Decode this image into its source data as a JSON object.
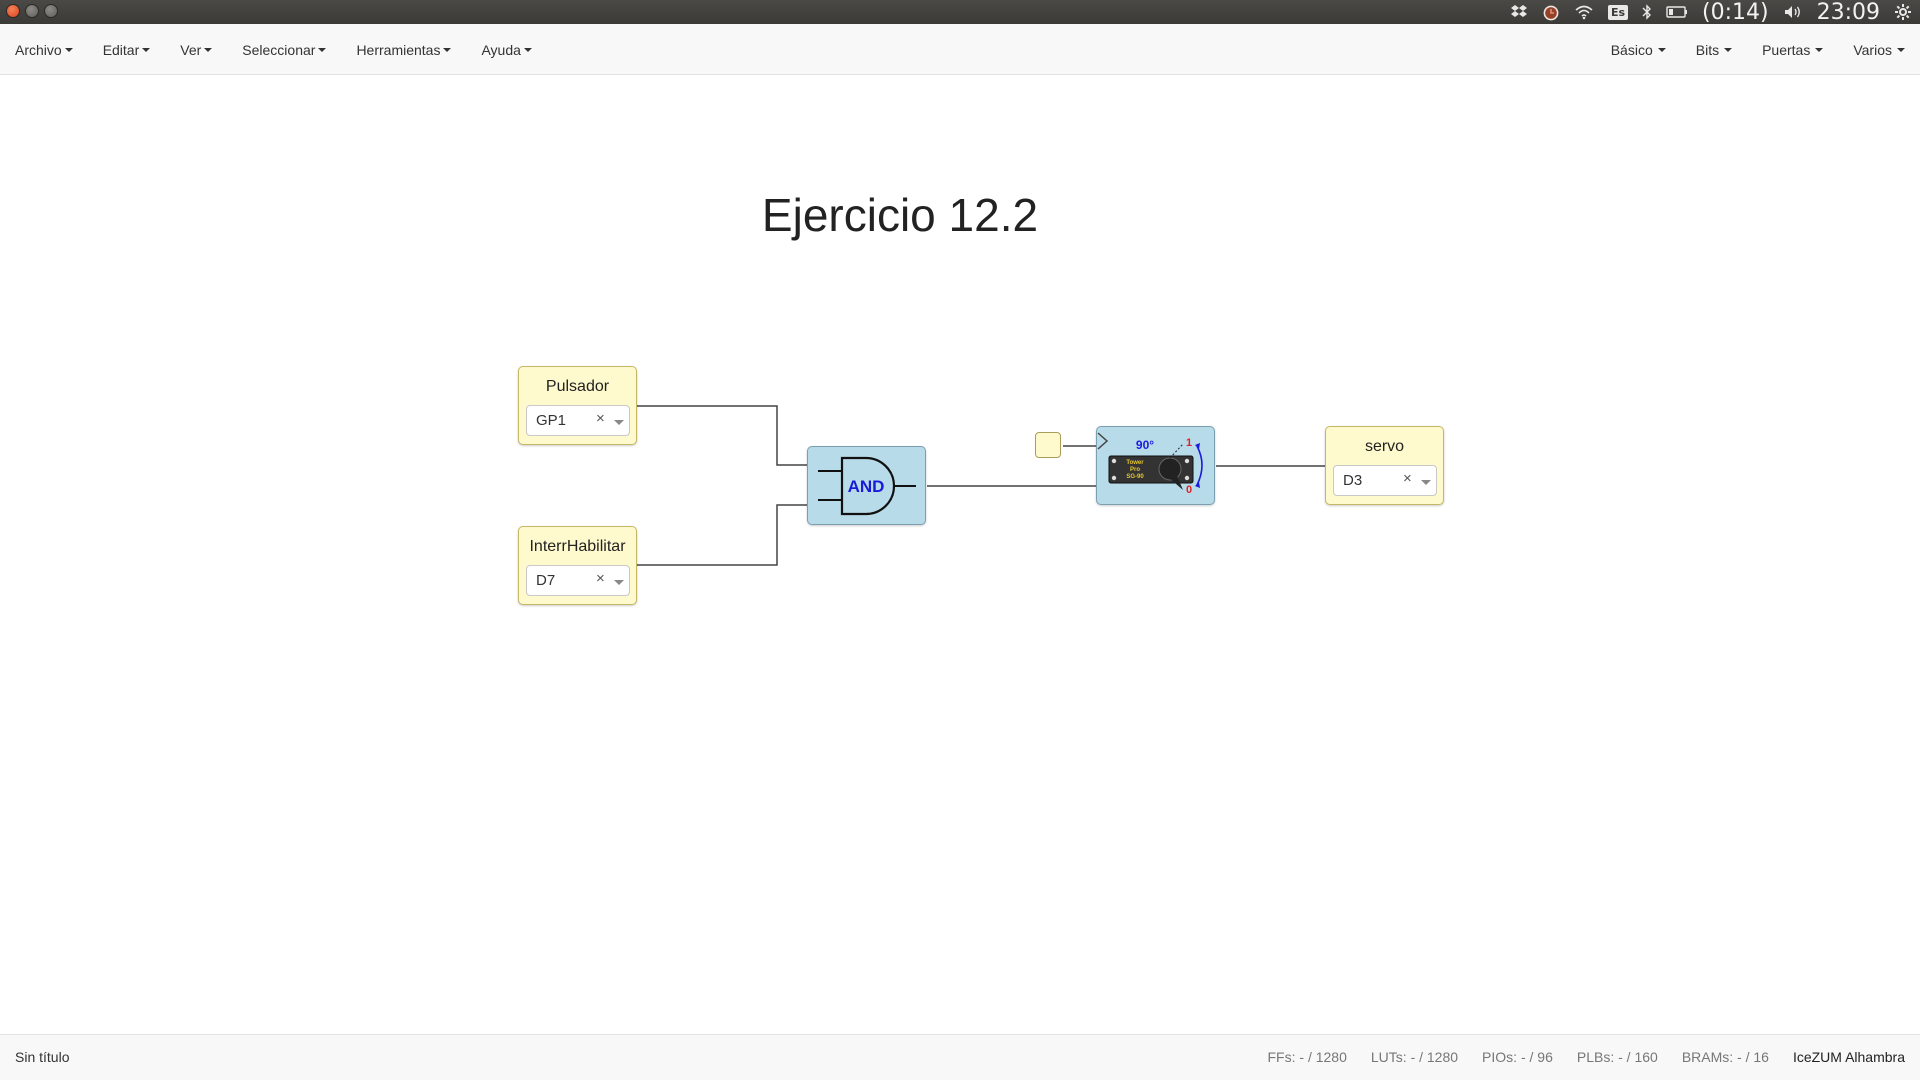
{
  "system_panel": {
    "battery_time": "(0:14)",
    "clock": "23:09",
    "keyboard_layout": "Es",
    "icons": [
      "dropbox-icon",
      "alarm-clock-icon",
      "wifi-icon",
      "keyboard-layout-icon",
      "bluetooth-icon",
      "battery-icon",
      "volume-icon",
      "settings-gear-icon"
    ]
  },
  "menubar": {
    "left": [
      {
        "label": "Archivo"
      },
      {
        "label": "Editar"
      },
      {
        "label": "Ver"
      },
      {
        "label": "Seleccionar"
      },
      {
        "label": "Herramientas"
      },
      {
        "label": "Ayuda"
      }
    ],
    "right": [
      {
        "label": "Básico"
      },
      {
        "label": "Bits"
      },
      {
        "label": "Puertas"
      },
      {
        "label": "Varios"
      }
    ]
  },
  "canvas": {
    "title": "Ejercicio 12.2",
    "blocks": {
      "pulsador": {
        "label": "Pulsador",
        "pin": "GP1",
        "clear": "×"
      },
      "interr": {
        "label": "InterrHabilitar",
        "pin": "D7",
        "clear": "×"
      },
      "and_gate": {
        "label": "AND"
      },
      "servo_module": {
        "angle": "90°",
        "top_mark": "1",
        "bottom_mark": "0",
        "body_text": [
          "Tower",
          "Pro",
          "SG-90"
        ]
      },
      "servo_out": {
        "label": "servo",
        "pin": "D3",
        "clear": "×"
      }
    },
    "colors": {
      "io_block": "#fffacd",
      "gate_block": "#b8dbe9",
      "and_text": "#1a1adb",
      "wire": "#444444"
    }
  },
  "footer": {
    "file_name": "Sin título",
    "stats": [
      {
        "label": "FFs:",
        "value": "- / 1280"
      },
      {
        "label": "LUTs:",
        "value": "- / 1280"
      },
      {
        "label": "PIOs:",
        "value": "- / 96"
      },
      {
        "label": "PLBs:",
        "value": "- / 160"
      },
      {
        "label": "BRAMs:",
        "value": "- / 16"
      }
    ],
    "board": "IceZUM Alhambra"
  }
}
